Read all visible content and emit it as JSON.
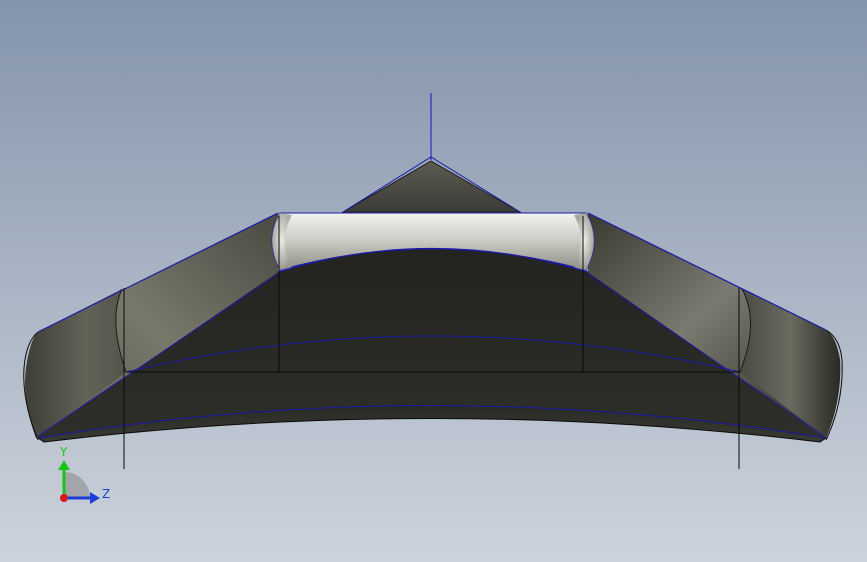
{
  "viewport": {
    "background_top": "#8494ab",
    "background_bottom": "#cdd3dc"
  },
  "model": {
    "edge_color": "#1a1aa8",
    "silhouette_color": "#0a0a0a",
    "axis_color": "#1515d0"
  },
  "triad": {
    "y_label": "Y",
    "z_label": "Z",
    "y_color": "#18c418",
    "z_color": "#1a3fd8",
    "x_color": "#d81818"
  }
}
